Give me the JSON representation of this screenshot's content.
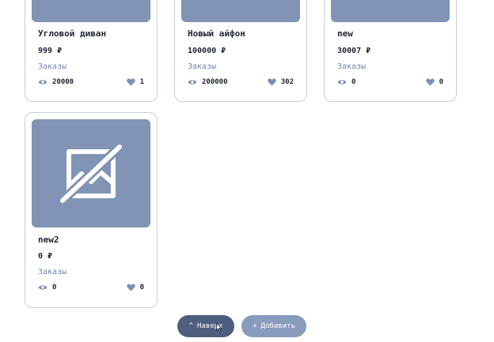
{
  "products": [
    {
      "title": "Угловой диван",
      "price": "999 ₽",
      "orders_label": "Заказы",
      "views": "20000",
      "likes": "1"
    },
    {
      "title": "Новый айфон",
      "price": "100000 ₽",
      "orders_label": "Заказы",
      "views": "200000",
      "likes": "302"
    },
    {
      "title": "new",
      "price": "30007 ₽",
      "orders_label": "Заказы",
      "views": "0",
      "likes": "0"
    },
    {
      "title": "new2",
      "price": "0 ₽",
      "orders_label": "Заказы",
      "views": "0",
      "likes": "0"
    }
  ],
  "icons": {
    "image_placeholder": "image-off-icon",
    "views": "eye-icon",
    "likes": "heart-icon",
    "up": "chevron-up-icon",
    "add": "plus-icon"
  },
  "actions": {
    "up_label": "Наверх",
    "up_symbol": "^",
    "add_label": "Добавить",
    "add_symbol": "+"
  },
  "colors": {
    "thumbnail_bg": "#8194b5",
    "link": "#7286a8",
    "button_dark": "#4e5e7e",
    "button_light": "#8a9cbd"
  }
}
